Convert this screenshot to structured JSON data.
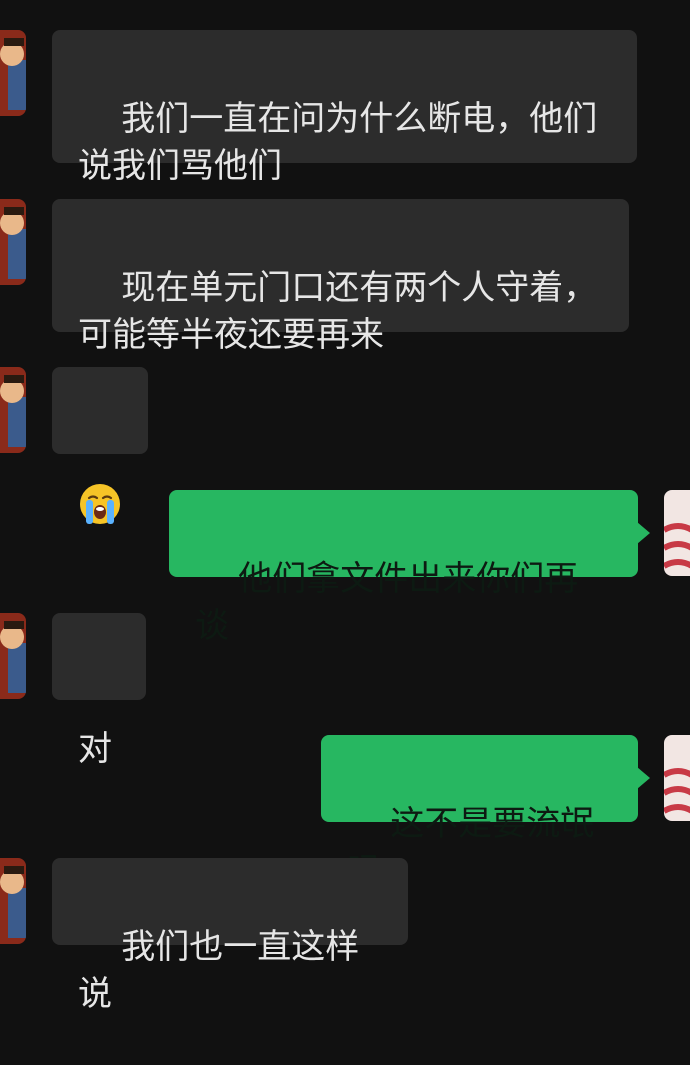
{
  "messages": [
    {
      "side": "in",
      "text": "我们一直在问为什么断电，他们\n说我们骂他们"
    },
    {
      "side": "in",
      "text": "现在单元门口还有两个人守着，\n可能等半夜还要再来"
    },
    {
      "side": "in",
      "emoji": "loudly-crying-face-emoji"
    },
    {
      "side": "out",
      "text": "他们拿文件出来你们再谈"
    },
    {
      "side": "in",
      "text": "对"
    },
    {
      "side": "out",
      "text": "这不是要流氓吗"
    },
    {
      "side": "in",
      "text": "我们也一直这样说"
    }
  ],
  "colors": {
    "background": "#111111",
    "incoming_bubble": "#2c2c2c",
    "outgoing_bubble": "#27b761",
    "incoming_text": "#e6e6e6",
    "outgoing_text": "#0d1a12"
  }
}
